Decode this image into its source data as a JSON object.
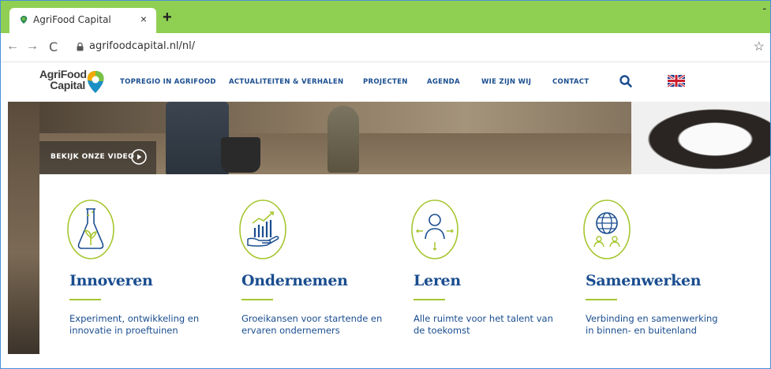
{
  "browser": {
    "tab_title": "AgriFood Capital",
    "tab_close": "×",
    "new_tab": "+",
    "window_min": "-",
    "url": "agrifoodcapital.nl/nl/",
    "back": "←",
    "forward": "→",
    "reload": "C",
    "bookmark": "☆"
  },
  "site": {
    "logo_line1": "AgriFood",
    "logo_line2": "Capital",
    "menu": [
      {
        "label": "TOPREGIO IN AGRIFOOD"
      },
      {
        "label": "ACTUALITEITEN & VERHALEN"
      },
      {
        "label": "PROJECTEN"
      },
      {
        "label": "AGENDA"
      },
      {
        "label": "WIE ZIJN WIJ"
      },
      {
        "label": "CONTACT"
      }
    ]
  },
  "hero": {
    "video_label": "BEKIJK ONZE VIDEO"
  },
  "cards": [
    {
      "title": "Innoveren",
      "desc": "Experiment, ontwikkeling en innovatie in proeftuinen",
      "icon": "flask-icon"
    },
    {
      "title": "Ondernemen",
      "desc": "Groeikansen voor startende en ervaren ondernemers",
      "icon": "growth-chart-hand-icon"
    },
    {
      "title": "Leren",
      "desc": "Alle ruimte voor het talent van de toekomst",
      "icon": "person-arrows-icon"
    },
    {
      "title": "Samenwerken",
      "desc": "Verbinding en samenwerking in binnen- en buitenland",
      "icon": "globe-people-icon"
    }
  ],
  "colors": {
    "tab_bar": "#8fcf52",
    "brand_blue": "#1a4d8f",
    "brand_green": "#a6c62f"
  }
}
